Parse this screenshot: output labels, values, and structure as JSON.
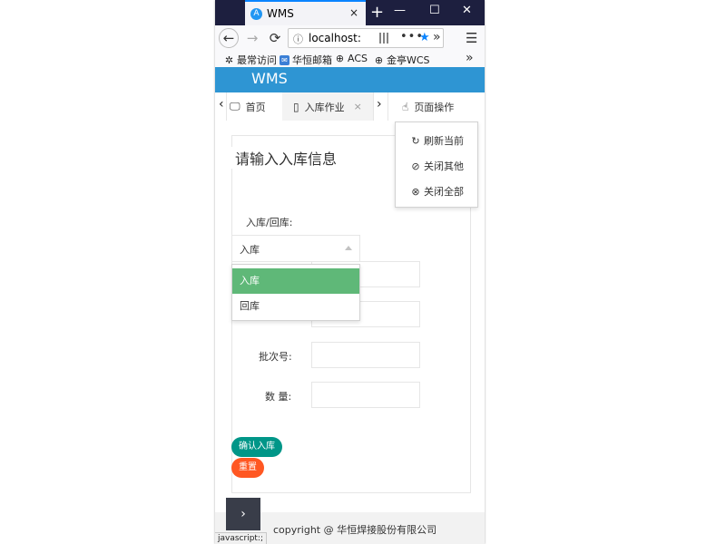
{
  "browser": {
    "tab_title": "WMS",
    "tab_close": "×",
    "new_tab": "+",
    "window_minimize": "—",
    "window_maximize": "☐",
    "window_close": "✕",
    "url": "localhost:",
    "url_more": "•••",
    "back_icon": "←",
    "forward_icon": "→",
    "reload_icon": "⟳",
    "menu_icon": "☰",
    "overflow": "»",
    "bookmarks": [
      {
        "label": "最常访问",
        "icon": "gear-icon"
      },
      {
        "label": "华恒邮箱",
        "icon": "mail-icon"
      },
      {
        "label": "ACS",
        "icon": "globe-icon"
      },
      {
        "label": "金亭WCS",
        "icon": "globe-icon"
      }
    ]
  },
  "app": {
    "title": "WMS"
  },
  "page_tabs": {
    "prev": "‹",
    "next": "›",
    "home_label": "首页",
    "inbound_label": "入库作业",
    "close": "×",
    "page_ops_label": "页面操作"
  },
  "context_menu": {
    "items": [
      {
        "label": "刷新当前",
        "icon": "refresh-icon"
      },
      {
        "label": "关闭其他",
        "icon": "block-icon"
      },
      {
        "label": "关闭全部",
        "icon": "close-circle-icon"
      }
    ]
  },
  "form": {
    "legend": "请输入入库信息",
    "type_label": "入库/回库:",
    "type_value": "入库",
    "type_options": [
      "入库",
      "回库"
    ],
    "batch_label": "批次号:",
    "qty_label": "数 量:",
    "confirm_label": "确认入库",
    "reset_label": "重置"
  },
  "footer": {
    "copyright": "copyright @ 华恒焊接股份有限公司",
    "toggle": "›"
  },
  "status_bar": "javascript:;",
  "colors": {
    "header": "#2e95d3",
    "selected_option": "#5fb878",
    "confirm_button": "#009688",
    "reset_button": "#ff5722"
  }
}
